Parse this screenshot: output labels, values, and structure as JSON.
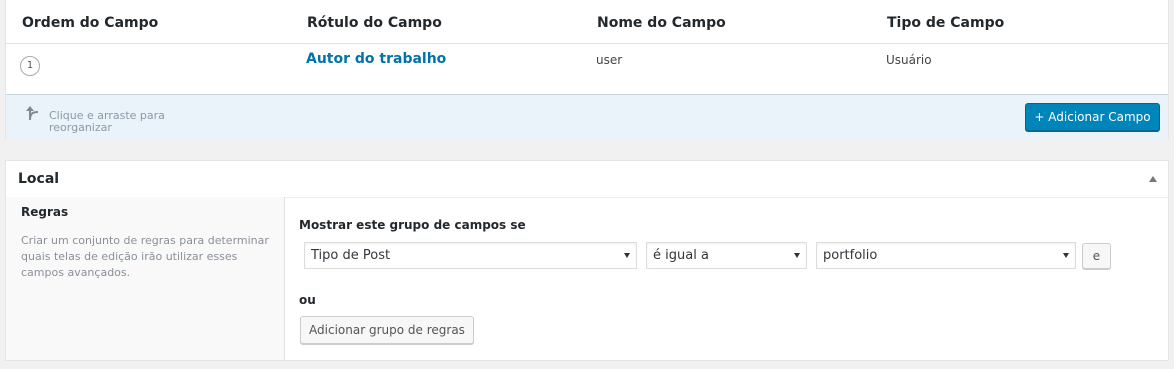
{
  "fields_table": {
    "columns": [
      "Ordem do Campo",
      "Rótulo do Campo",
      "Nome do Campo",
      "Tipo de Campo"
    ],
    "rows": [
      {
        "order": "1",
        "label": "Autor do trabalho",
        "name": "user",
        "type": "Usuário"
      }
    ],
    "drag_hint": "Clique e arraste para reorganizar",
    "add_field_button": "+ Adicionar Campo",
    "accent_color": "#0085ba"
  },
  "location": {
    "title": "Local",
    "rules_title": "Regras",
    "rules_description": "Criar um conjunto de regras para determinar quais telas de edição irão utilizar esses campos avançados.",
    "show_if_label": "Mostrar este grupo de campos se",
    "rule": {
      "param": "Tipo de Post",
      "operator": "é igual a",
      "value": "portfolio"
    },
    "and_button": "e",
    "or_label": "ou",
    "add_group_button": "Adicionar grupo de regras"
  }
}
